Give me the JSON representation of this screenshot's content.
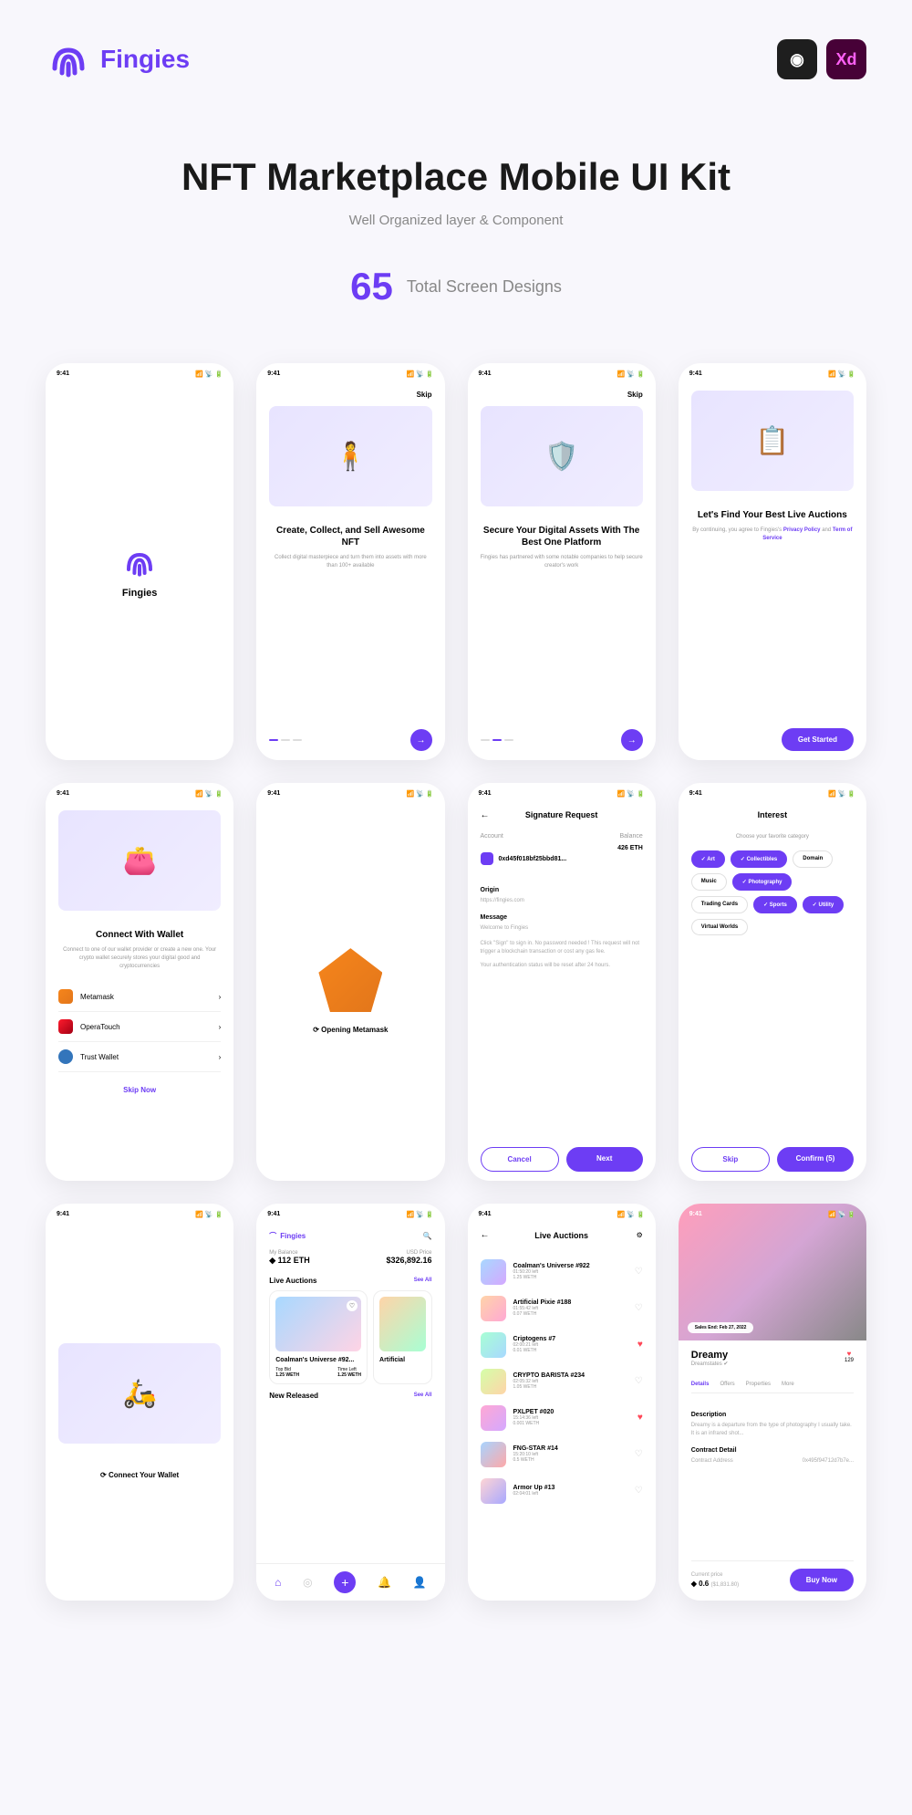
{
  "brand": "Fingies",
  "hero": {
    "title": "NFT Marketplace Mobile UI Kit",
    "subtitle": "Well Organized layer & Component",
    "count": "65",
    "count_label": "Total Screen Designs"
  },
  "status": {
    "time": "9:41",
    "right": "📶 📡 🔋"
  },
  "onboard": [
    {
      "skip": "Skip",
      "title": "Create, Collect, and Sell Awesome NFT",
      "desc": "Collect digital masterpiece and turn them into assets with more than 100+ available"
    },
    {
      "skip": "Skip",
      "title": "Secure Your Digital Assets With The Best One Platform",
      "desc": "Fingies has partnered with some notable companies to help secure creator's work"
    },
    {
      "title": "Let's Find Your Best Live Auctions",
      "desc_pre": "By continuing, you agree to Fingies's ",
      "link1": "Privacy Policy",
      "mid": " and ",
      "link2": "Term of Service",
      "cta": "Get Started"
    }
  ],
  "wallet": {
    "title": "Connect With Wallet",
    "desc": "Connect to one of our wallet provider or create a new one. Your crypto wallet securely stores your digital good and cryptocurrencies",
    "items": [
      "Metamask",
      "OperaTouch",
      "Trust Wallet"
    ],
    "skip": "Skip Now"
  },
  "opening": "Opening Metamask",
  "sig": {
    "title": "Signature Request",
    "account_label": "Account",
    "balance_label": "Balance",
    "account": "0xd45f018bf25bbd81...",
    "balance": "426 ETH",
    "origin_label": "Origin",
    "origin": "https://fingies.com",
    "msg_label": "Message",
    "msg": "Welcome to Fingies",
    "note1": "Click \"Sign\" to sign in. No password needed ! This request will not trigger a blockchain transaction or cost any gas fee.",
    "note2": "Your authentication status will be reset after 24 hours.",
    "cancel": "Cancel",
    "next": "Next"
  },
  "interest": {
    "title": "Interest",
    "subtitle": "Choose your favorite category",
    "chips": [
      {
        "t": "Art",
        "on": true
      },
      {
        "t": "Collectibles",
        "on": true
      },
      {
        "t": "Domain",
        "on": false
      },
      {
        "t": "Music",
        "on": false
      },
      {
        "t": "Photography",
        "on": true
      },
      {
        "t": "Trading Cards",
        "on": false
      },
      {
        "t": "Sports",
        "on": true
      },
      {
        "t": "Utility",
        "on": true
      },
      {
        "t": "Virtual Worlds",
        "on": false
      }
    ],
    "skip": "Skip",
    "confirm": "Confirm (5)"
  },
  "connect": "Connect Your Wallet",
  "home": {
    "balance_label": "My Balance",
    "balance": "◆ 112 ETH",
    "usd_label": "USD Price",
    "usd": "$326,892.16",
    "sec1": "Live Auctions",
    "see": "See All",
    "card_title": "Coalman's Universe #92...",
    "card2": "Artificial",
    "top_bid_l": "Top Bid",
    "top_bid": "1.25 WETH",
    "time_l": "Time Left",
    "time": "1.25 WETH",
    "sec2": "New Released"
  },
  "auctions": {
    "title": "Live Auctions",
    "items": [
      {
        "t": "Coalman's Universe #922",
        "s": "01:50:20 left",
        "p": "1.25 WETH",
        "fav": false
      },
      {
        "t": "Artificial Pixie #188",
        "s": "01:55:42 left",
        "p": "0.07 WETH",
        "fav": false
      },
      {
        "t": "Criptogens #7",
        "s": "02:00:21 left",
        "p": "0.01 WETH",
        "fav": true
      },
      {
        "t": "CRYPTO BARISTA #234",
        "s": "02:05:32 left",
        "p": "1.05 WETH",
        "fav": false
      },
      {
        "t": "PXLPET #020",
        "s": "15:14:36 left",
        "p": "0.001 WETH",
        "fav": true
      },
      {
        "t": "FNG-STAR #14",
        "s": "15:20:10 left",
        "p": "0.5 WETH",
        "fav": false
      },
      {
        "t": "Armor Up #13",
        "s": "02:04:01 left",
        "p": "",
        "fav": false
      }
    ]
  },
  "detail": {
    "sale": "Sales End: Feb 27, 2022",
    "title": "Dreamy",
    "author": "Dreamstates ✔",
    "likes": "129",
    "tabs": [
      "Details",
      "Offers",
      "Properties",
      "More"
    ],
    "desc_label": "Description",
    "desc": "Dreamy is a departure from the type of photography I usually take. It is an infrared shot...",
    "contract_label": "Contract Detail",
    "addr_label": "Contract Address",
    "addr": "0x495f94712d7b7e...",
    "price_label": "Current price",
    "price": "◆ 0.6",
    "price_usd": "($1,831.80)",
    "buy": "Buy Now"
  }
}
